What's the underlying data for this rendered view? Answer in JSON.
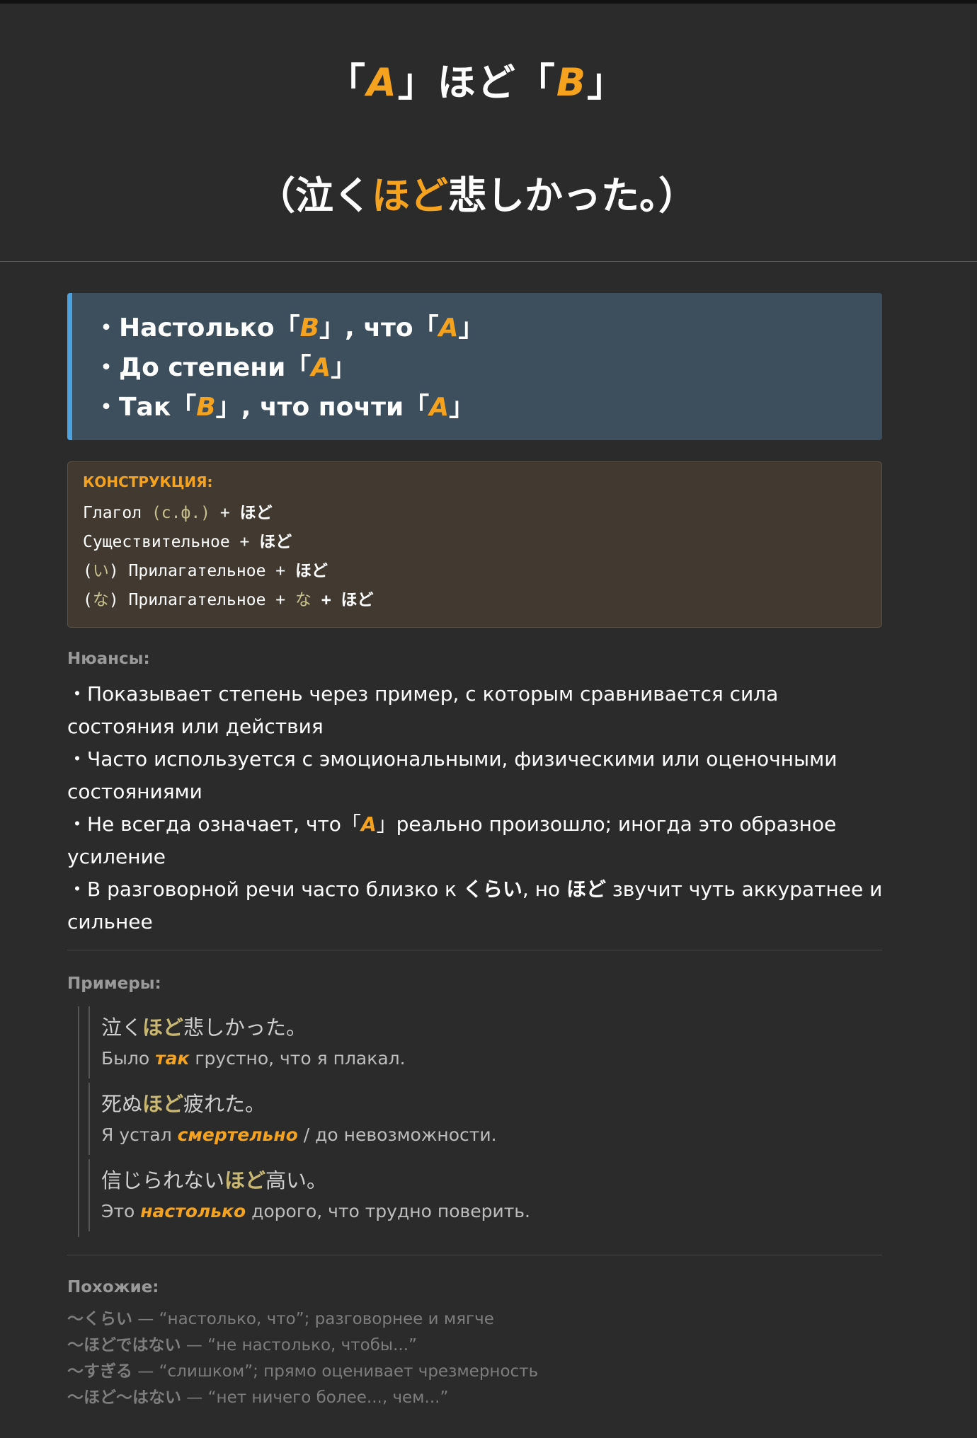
{
  "header": {
    "title": {
      "q1": "「",
      "a": "A",
      "q2": "」ほど「",
      "b": "B",
      "q3": "」"
    },
    "example": {
      "pre": "（泣く",
      "hl": "ほど",
      "post": "悲しかった。）"
    }
  },
  "meanings": [
    {
      "t1": "・Настолько「",
      "v1": "B",
      "t2": "」, что「",
      "v2": "A",
      "t3": "」"
    },
    {
      "t1": "・До степени「",
      "v1": "A",
      "t2": "」",
      "v2": "",
      "t3": ""
    },
    {
      "t1": "・Так「",
      "v1": "B",
      "t2": "」, что почти「",
      "v2": "A",
      "t3": "」"
    }
  ],
  "construction": {
    "label": "КОНСТРУКЦИЯ:",
    "lines": [
      {
        "a": "Глагол ",
        "m1": "(с.ф.)",
        "b": " + ",
        "c": "ほど",
        "m2": "",
        "d": ""
      },
      {
        "a": "Существительное + ",
        "m1": "",
        "b": "",
        "c": "ほど",
        "m2": "",
        "d": ""
      },
      {
        "a": "(",
        "m1": "い",
        "b": ") Прилагательное + ",
        "c": "ほど",
        "m2": "",
        "d": ""
      },
      {
        "a": "(",
        "m1": "な",
        "b": ") Прилагательное + ",
        "c": "",
        "m2": "な",
        "d": " + ほど"
      }
    ]
  },
  "nuances": {
    "label": "Нюансы:",
    "items": [
      {
        "t1": "・Показывает степень через пример, с которым сравнивается сила состояния или действия"
      },
      {
        "t1": "・Часто используется с эмоциональными, физическими или оценочными состояниями"
      },
      {
        "t1": "・Не всегда означает, что「",
        "hl": "A",
        "t2": "」реально произошло; иногда это образное усиление"
      },
      {
        "t1": "・В разговорной речи часто близко к ",
        "b1": "くらい",
        "t2": ", но ",
        "b2": "ほど",
        "t3": " звучит чуть аккуратнее и сильнее"
      }
    ]
  },
  "examples": {
    "label": "Примеры:",
    "items": [
      {
        "jp_pre": "泣く",
        "jp_hl": "ほど",
        "jp_post": "悲しかった。",
        "ru_pre": "Было ",
        "ru_hl": "так",
        "ru_post": " грустно, что я плакал."
      },
      {
        "jp_pre": "死ぬ",
        "jp_hl": "ほど",
        "jp_post": "疲れた。",
        "ru_pre": "Я устал ",
        "ru_hl": "смертельно",
        "ru_post": " / до невозможности."
      },
      {
        "jp_pre": "信じられない",
        "jp_hl": "ほど",
        "jp_post": "高い。",
        "ru_pre": "Это ",
        "ru_hl": "настолько",
        "ru_post": " дорого, что трудно поверить."
      }
    ]
  },
  "similar": {
    "label": "Похожие:",
    "items": [
      {
        "term": "〜くらい",
        "desc": " — “настолько, что”; разговорнее и мягче"
      },
      {
        "term": "〜ほどではない",
        "desc": " — “не настолько, чтобы...”"
      },
      {
        "term": "〜すぎる",
        "desc": " — “слишком”; прямо оценивает чрезмерность"
      },
      {
        "term": "〜ほど〜はない",
        "desc": " — “нет ничего более..., чем...”"
      }
    ]
  }
}
